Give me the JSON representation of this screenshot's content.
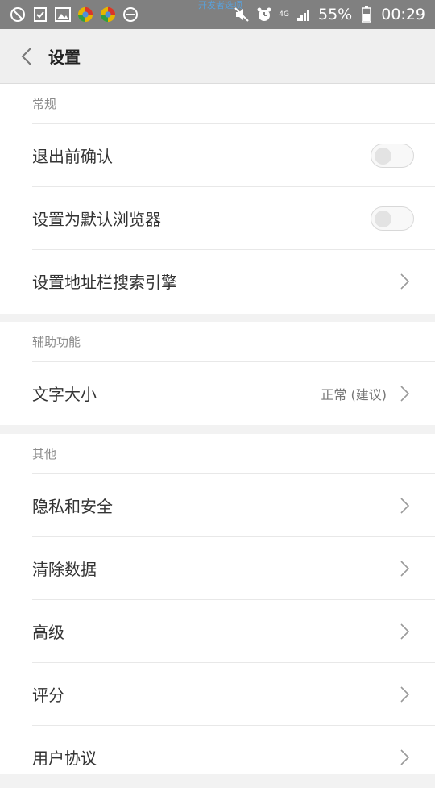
{
  "status_bar": {
    "center_text": "开发者选项",
    "battery": "55%",
    "time": "00:29",
    "network": "4G"
  },
  "header": {
    "title": "设置"
  },
  "sections": [
    {
      "title": "常规",
      "items": [
        {
          "label": "退出前确认",
          "type": "toggle",
          "on": false
        },
        {
          "label": "设置为默认浏览器",
          "type": "toggle",
          "on": false
        },
        {
          "label": "设置地址栏搜索引擎",
          "type": "link"
        }
      ]
    },
    {
      "title": "辅助功能",
      "items": [
        {
          "label": "文字大小",
          "type": "link",
          "value": "正常 (建议)"
        }
      ]
    },
    {
      "title": "其他",
      "items": [
        {
          "label": "隐私和安全",
          "type": "link"
        },
        {
          "label": "清除数据",
          "type": "link"
        },
        {
          "label": "高级",
          "type": "link"
        },
        {
          "label": "评分",
          "type": "link"
        },
        {
          "label": "用户协议",
          "type": "link"
        }
      ]
    }
  ],
  "colors": {
    "statusbar": "#808080",
    "header_bg": "#efefef",
    "section_gap": "#f2f2f2",
    "label": "#333333",
    "section_title": "#8a8a8a"
  }
}
